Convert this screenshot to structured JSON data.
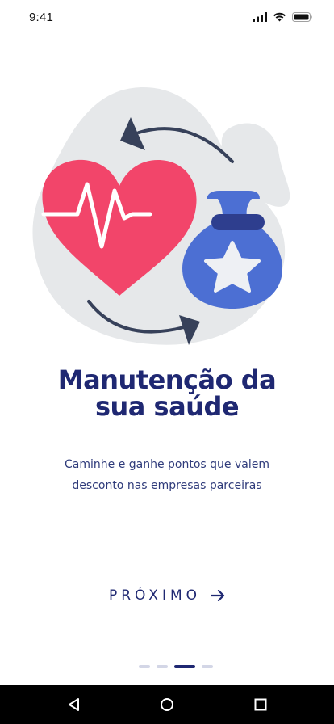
{
  "status_bar": {
    "time": "9:41",
    "icons": [
      "cellular-signal-icon",
      "wifi-icon",
      "battery-icon"
    ]
  },
  "illustration": {
    "icons": [
      "heart-pulse-icon",
      "money-bag-star-icon",
      "cycle-arrows-icon"
    ],
    "colors": {
      "blob": "#e6e8ea",
      "heart": "#f2456a",
      "bag": "#4c6fd3",
      "bag_tie": "#2e3e8e",
      "star": "#eef0f4",
      "arrows": "#37415a"
    }
  },
  "onboarding": {
    "title_line1": "Manutenção da",
    "title_line2": "sua saúde",
    "subtitle_line1": "Caminhe e ganhe pontos que valem",
    "subtitle_line2": "desconto nas empresas parceiras",
    "next_label": "PRÓXIMO",
    "next_icon": "arrow-right-icon",
    "page_count": 4,
    "current_page": 3
  },
  "nav_bar": {
    "buttons": [
      "back-triangle-icon",
      "home-circle-icon",
      "recents-square-icon"
    ]
  },
  "colors": {
    "primary": "#1f2872",
    "indicator_inactive": "#d3d6e6",
    "background": "#ffffff"
  }
}
